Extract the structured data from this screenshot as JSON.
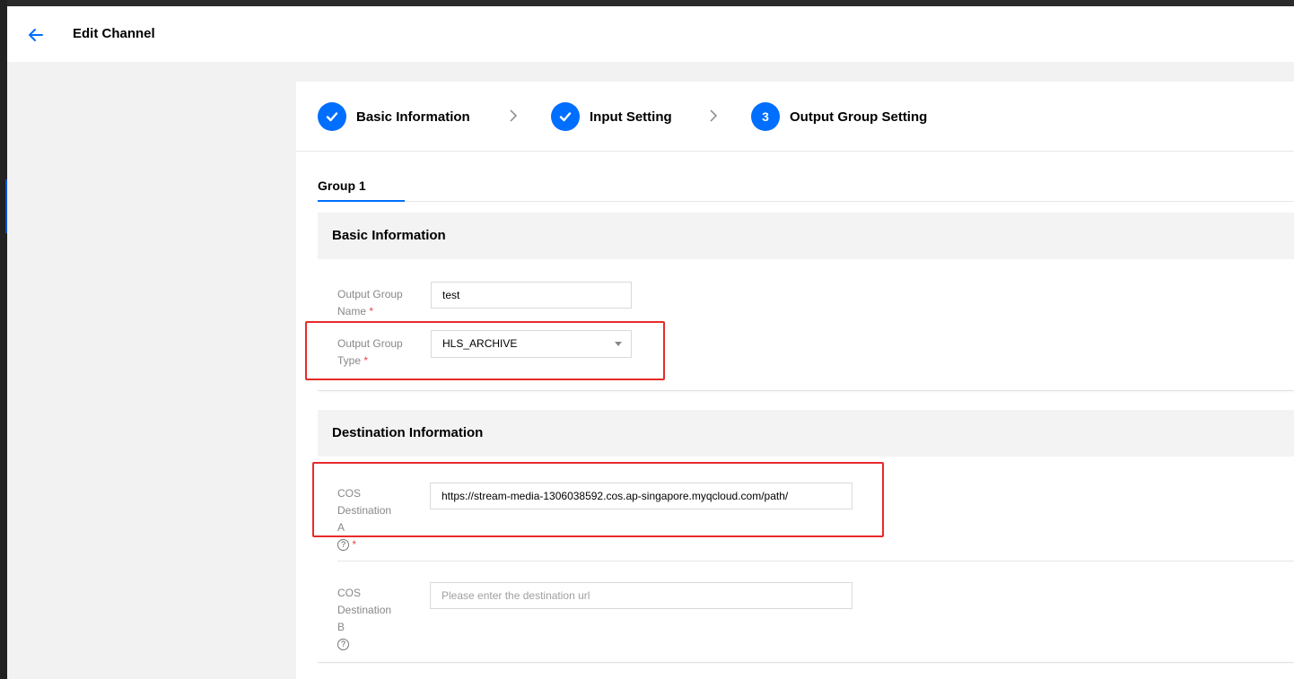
{
  "header": {
    "title": "Edit Channel"
  },
  "steps": [
    {
      "label": "Basic Information",
      "status": "done"
    },
    {
      "label": "Input Setting",
      "status": "done"
    },
    {
      "label": "Output Group Setting",
      "number": "3",
      "status": "active"
    }
  ],
  "tabs": [
    {
      "label": "Group 1"
    }
  ],
  "basic_info": {
    "title": "Basic Information",
    "output_group_name": {
      "label": "Output Group Name",
      "value": "test"
    },
    "output_group_type": {
      "label": "Output Group Type",
      "value": "HLS_ARCHIVE"
    }
  },
  "destination_info": {
    "title": "Destination Information",
    "cos_a": {
      "label": "COS Destination A",
      "value": "https://stream-media-1306038592.cos.ap-singapore.myqcloud.com/path/"
    },
    "cos_b": {
      "label": "COS Destination B",
      "placeholder": "Please enter the destination url",
      "value": ""
    }
  },
  "required_mark": "*",
  "help_glyph": "?",
  "colors": {
    "accent": "#006eff",
    "highlight": "#e62b2b",
    "required": "#e54545"
  }
}
